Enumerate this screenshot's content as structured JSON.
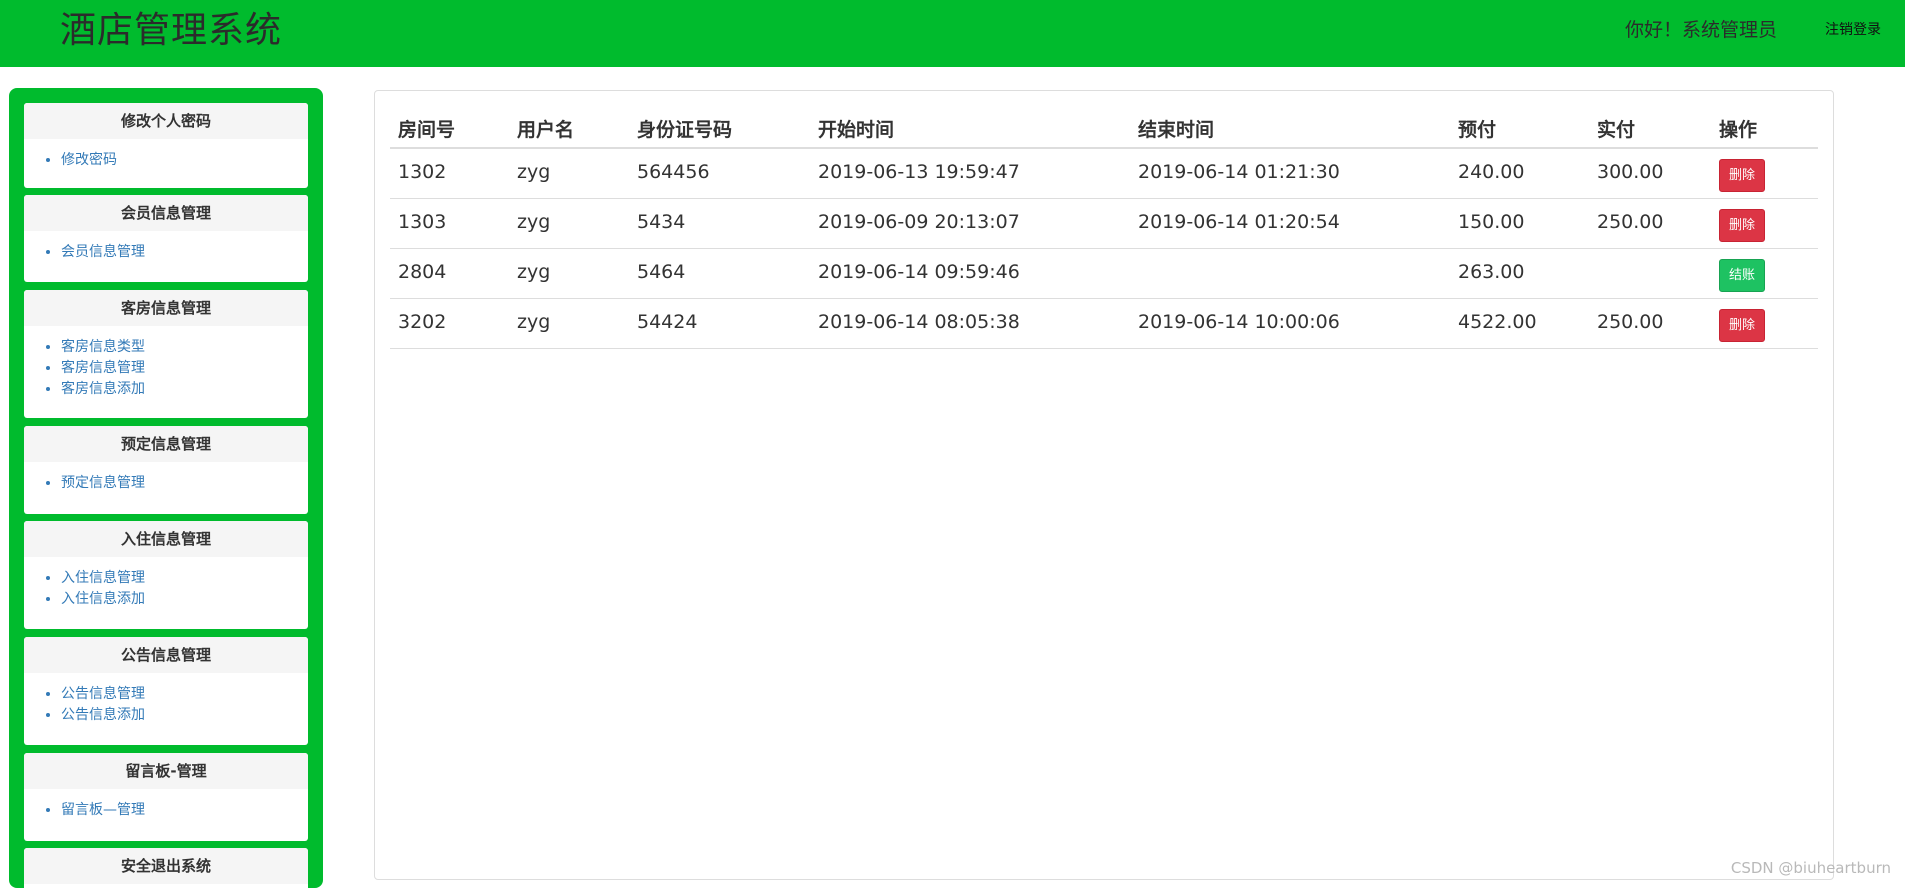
{
  "header": {
    "brand": "酒店管理系统",
    "greeting": "你好！系统管理员",
    "logout": "注销登录"
  },
  "sidebar": {
    "panels": [
      {
        "title": "修改个人密码",
        "items": [
          "修改密码"
        ]
      },
      {
        "title": "会员信息管理",
        "items": [
          "会员信息管理"
        ]
      },
      {
        "title": "客房信息管理",
        "items": [
          "客房信息类型",
          "客房信息管理",
          "客房信息添加"
        ]
      },
      {
        "title": "预定信息管理",
        "items": [
          "预定信息管理"
        ]
      },
      {
        "title": "入住信息管理",
        "items": [
          "入住信息管理",
          "入住信息添加"
        ]
      },
      {
        "title": "公告信息管理",
        "items": [
          "公告信息管理",
          "公告信息添加"
        ]
      },
      {
        "title": "留言板-管理",
        "items": [
          "留言板—管理"
        ]
      },
      {
        "title": "安全退出系统",
        "items": []
      }
    ]
  },
  "table": {
    "headers": [
      "房间号",
      "用户名",
      "身份证号码",
      "开始时间",
      "结束时间",
      "预付",
      "实付",
      "操作"
    ],
    "rows": [
      {
        "room": "1302",
        "user": "zyg",
        "id": "564456",
        "start": "2019-06-13 19:59:47",
        "end": "2019-06-14 01:21:30",
        "prepaid": "240.00",
        "paid": "300.00",
        "action": "删除",
        "action_type": "danger"
      },
      {
        "room": "1303",
        "user": "zyg",
        "id": "5434",
        "start": "2019-06-09 20:13:07",
        "end": "2019-06-14 01:20:54",
        "prepaid": "150.00",
        "paid": "250.00",
        "action": "删除",
        "action_type": "danger"
      },
      {
        "room": "2804",
        "user": "zyg",
        "id": "5464",
        "start": "2019-06-14 09:59:46",
        "end": "",
        "prepaid": "263.00",
        "paid": "",
        "action": "结账",
        "action_type": "success"
      },
      {
        "room": "3202",
        "user": "zyg",
        "id": "54424",
        "start": "2019-06-14 08:05:38",
        "end": "2019-06-14 10:00:06",
        "prepaid": "4522.00",
        "paid": "250.00",
        "action": "删除",
        "action_type": "danger"
      }
    ]
  },
  "watermark": "CSDN @biuheartburn",
  "colors": {
    "header_green": "#00bb2d",
    "delete_red": "#dc3545",
    "checkout_green": "#1ec262",
    "link_blue": "#337ab7"
  }
}
